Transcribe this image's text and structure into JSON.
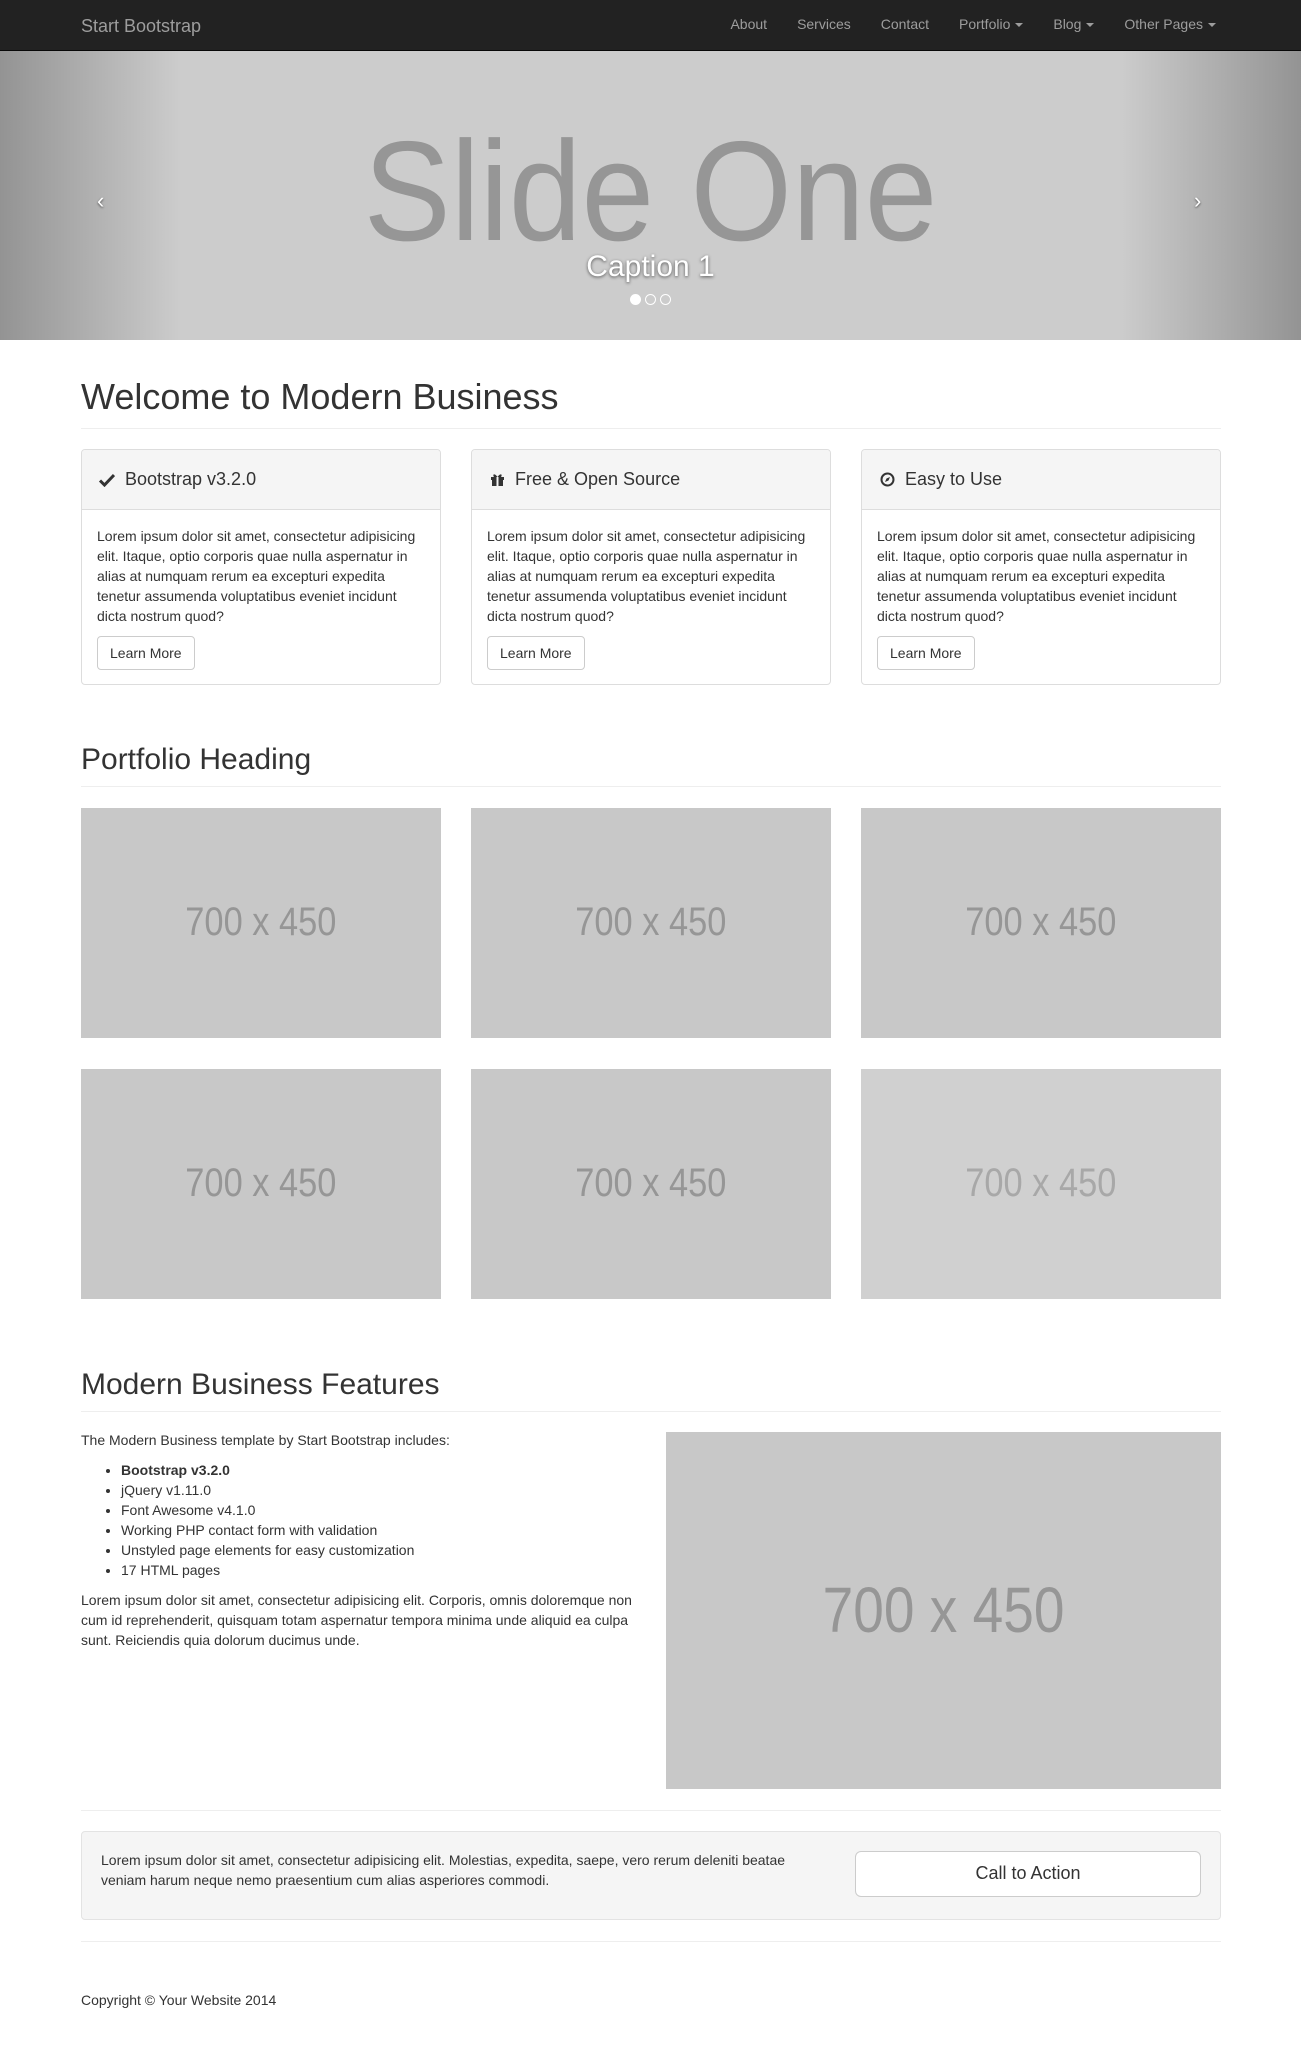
{
  "navbar": {
    "brand": "Start Bootstrap",
    "items": [
      {
        "label": "About",
        "dropdown": false
      },
      {
        "label": "Services",
        "dropdown": false
      },
      {
        "label": "Contact",
        "dropdown": false
      },
      {
        "label": "Portfolio",
        "dropdown": true
      },
      {
        "label": "Blog",
        "dropdown": true
      },
      {
        "label": "Other Pages",
        "dropdown": true
      }
    ]
  },
  "carousel": {
    "slide_text": "Slide One",
    "caption": "Caption 1",
    "prev_icon": "‹",
    "next_icon": "›",
    "active_index": 0,
    "indicator_count": 3
  },
  "welcome": {
    "heading": "Welcome to Modern Business",
    "panels": [
      {
        "icon": "check-icon",
        "title": "Bootstrap v3.2.0",
        "body": "Lorem ipsum dolor sit amet, consectetur adipisicing elit. Itaque, optio corporis quae nulla aspernatur in alias at numquam rerum ea excepturi expedita tenetur assumenda voluptatibus eveniet incidunt dicta nostrum quod?",
        "button": "Learn More"
      },
      {
        "icon": "gift-icon",
        "title": "Free & Open Source",
        "body": "Lorem ipsum dolor sit amet, consectetur adipisicing elit. Itaque, optio corporis quae nulla aspernatur in alias at numquam rerum ea excepturi expedita tenetur assumenda voluptatibus eveniet incidunt dicta nostrum quod?",
        "button": "Learn More"
      },
      {
        "icon": "compass-icon",
        "title": "Easy to Use",
        "body": "Lorem ipsum dolor sit amet, consectetur adipisicing elit. Itaque, optio corporis quae nulla aspernatur in alias at numquam rerum ea excepturi expedita tenetur assumenda voluptatibus eveniet incidunt dicta nostrum quod?",
        "button": "Learn More"
      }
    ]
  },
  "portfolio": {
    "heading": "Portfolio Heading",
    "items": [
      "700 x 450",
      "700 x 450",
      "700 x 450",
      "700 x 450",
      "700 x 450",
      "700 x 450"
    ]
  },
  "features": {
    "heading": "Modern Business Features",
    "intro": "The Modern Business template by Start Bootstrap includes:",
    "list": [
      {
        "text": "Bootstrap v3.2.0",
        "bold": true
      },
      {
        "text": "jQuery v1.11.0",
        "bold": false
      },
      {
        "text": "Font Awesome v4.1.0",
        "bold": false
      },
      {
        "text": "Working PHP contact form with validation",
        "bold": false
      },
      {
        "text": "Unstyled page elements for easy customization",
        "bold": false
      },
      {
        "text": "17 HTML pages",
        "bold": false
      }
    ],
    "paragraph": "Lorem ipsum dolor sit amet, consectetur adipisicing elit. Corporis, omnis doloremque non cum id reprehenderit, quisquam totam aspernatur tempora minima unde aliquid ea culpa sunt. Reiciendis quia dolorum ducimus unde.",
    "image_label": "700 x 450"
  },
  "cta": {
    "text": "Lorem ipsum dolor sit amet, consectetur adipisicing elit. Molestias, expedita, saepe, vero rerum deleniti beatae veniam harum neque nemo praesentium cum alias asperiores commodi.",
    "button": "Call to Action"
  },
  "footer": {
    "copyright": "Copyright © Your Website 2014"
  }
}
